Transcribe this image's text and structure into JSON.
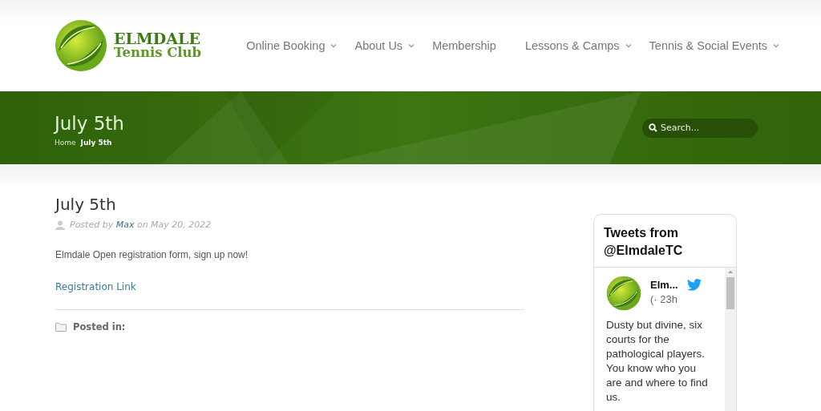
{
  "logo": {
    "line_1": "ELMDALE",
    "line_2": "Tennis Club"
  },
  "nav": [
    {
      "label": "Online Booking",
      "has_submenu": true
    },
    {
      "label": "About Us",
      "has_submenu": true
    },
    {
      "label": "Membership",
      "has_submenu": false
    },
    {
      "label": "Lessons & Camps",
      "has_submenu": true
    },
    {
      "label": "Tennis & Social Events",
      "has_submenu": true
    }
  ],
  "banner": {
    "title": "July 5th",
    "breadcrumbs": [
      {
        "label": "Home",
        "current": false
      },
      {
        "label": "July 5th",
        "current": true
      }
    ],
    "search": {
      "placeholder": "Search..."
    }
  },
  "post": {
    "title": "July 5th",
    "meta_prefix": "Posted by",
    "author": "Max",
    "meta_suffix": "on May 20, 2022",
    "body": "Elmdale Open registration form, sign up now!",
    "link": "Registration Link",
    "posted_in": "Posted in:"
  },
  "twitter": {
    "title": "Tweets from @ElmdaleTC",
    "tweet": {
      "name": "Elm...",
      "handle_time": "(· 23h",
      "text": "Dusty but divine, six courts for the pathological players. You know who you are and where to find us."
    }
  }
}
